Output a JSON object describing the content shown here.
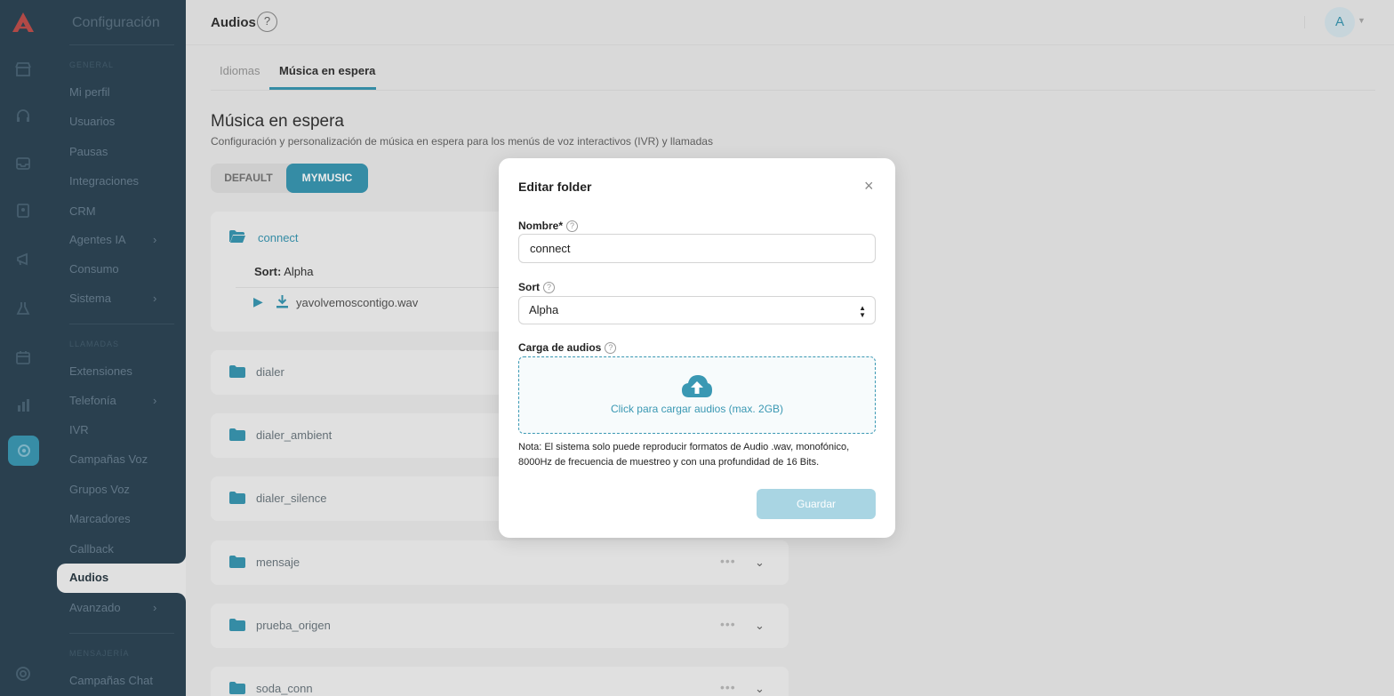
{
  "sidebar": {
    "config_title": "Configuración",
    "sections": [
      "GENERAL",
      "LLAMADAS",
      "MENSAJERÍA"
    ],
    "items": [
      "Mi perfil",
      "Usuarios",
      "Pausas",
      "Integraciones",
      "CRM",
      "Agentes IA",
      "Consumo",
      "Sistema",
      "Extensiones",
      "Telefonía",
      "IVR",
      "Campañas Voz",
      "Grupos Voz",
      "Marcadores",
      "Callback",
      "Audios",
      "Avanzado",
      "Campañas Chat"
    ]
  },
  "header": {
    "title": "Audios",
    "help": "?",
    "avatar": "A"
  },
  "tabs": [
    "Idiomas",
    "Música en espera"
  ],
  "page": {
    "title": "Música en espera",
    "subtitle": "Configuración y personalización de música en espera para los menús de voz interactivos (IVR) y llamadas"
  },
  "toggle": {
    "default": "DEFAULT",
    "mymusic": "MYMUSIC"
  },
  "connect_card": {
    "name": "connect",
    "sort_label": "Sort:",
    "sort_value": "Alpha",
    "file": "yavolvemoscontigo.wav"
  },
  "folders": [
    "dialer",
    "dialer_ambient",
    "dialer_silence",
    "mensaje",
    "prueba_origen",
    "soda_conn"
  ],
  "modal": {
    "title": "Editar folder",
    "close": "×",
    "name_label": "Nombre*",
    "name_value": "connect",
    "sort_label": "Sort",
    "sort_value": "Alpha",
    "upload_label": "Carga de audios",
    "upload_text": "Click para cargar audios (max. 2GB)",
    "note": "Nota: El sistema solo puede reproducir formatos de Audio .wav, monofónico, 8000Hz de frecuencia de muestreo y con una profundidad de 16 Bits.",
    "save": "Guardar"
  },
  "colors": {
    "accent": "#3a98b3",
    "sidebar": "#2e4656",
    "save_btn": "#a9d5e3"
  }
}
